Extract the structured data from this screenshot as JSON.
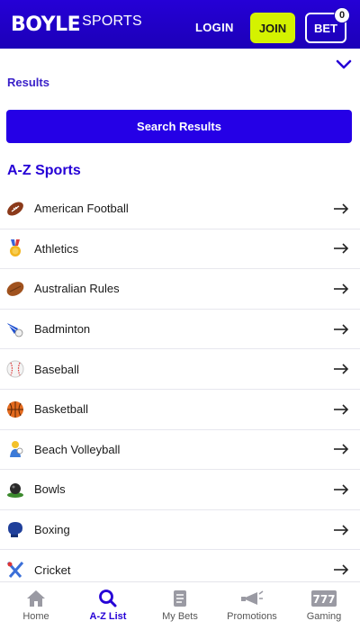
{
  "header": {
    "logo_main": "BOYLE",
    "logo_sub": "SPORTS",
    "login": "LOGIN",
    "join": "JOIN",
    "bet": "BET",
    "bet_count": "0"
  },
  "filter": {
    "partial_text": "Results"
  },
  "search_button": "Search Results",
  "section_title": "A-Z Sports",
  "sports": [
    {
      "label": "American Football",
      "icon": "american-football-icon"
    },
    {
      "label": "Athletics",
      "icon": "medal-icon"
    },
    {
      "label": "Australian Rules",
      "icon": "rugby-ball-icon"
    },
    {
      "label": "Badminton",
      "icon": "shuttlecock-icon"
    },
    {
      "label": "Baseball",
      "icon": "baseball-icon"
    },
    {
      "label": "Basketball",
      "icon": "basketball-icon"
    },
    {
      "label": "Beach Volleyball",
      "icon": "volleyball-icon"
    },
    {
      "label": "Bowls",
      "icon": "bowls-icon"
    },
    {
      "label": "Boxing",
      "icon": "boxing-glove-icon"
    },
    {
      "label": "Cricket",
      "icon": "cricket-icon"
    }
  ],
  "bottom_nav": [
    {
      "label": "Home",
      "icon": "home-icon"
    },
    {
      "label": "A-Z List",
      "icon": "search-icon",
      "active": true
    },
    {
      "label": "My Bets",
      "icon": "bet-slip-icon"
    },
    {
      "label": "Promotions",
      "icon": "megaphone-icon"
    },
    {
      "label": "Gaming",
      "icon": "slot-777-icon"
    }
  ],
  "colors": {
    "brand": "#2500d6",
    "join": "#d4f200"
  }
}
